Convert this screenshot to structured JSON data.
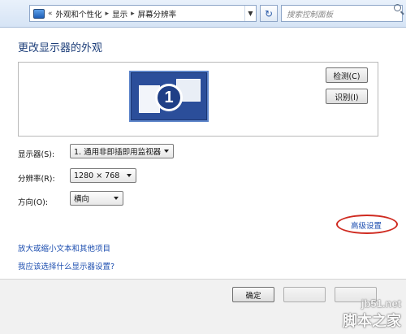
{
  "address_bar": {
    "breadcrumbs": [
      "外观和个性化",
      "显示",
      "屏幕分辨率"
    ],
    "prefix": "«",
    "separator": "▸",
    "search_placeholder": "搜索控制面板"
  },
  "page": {
    "title": "更改显示器的外观"
  },
  "preview": {
    "monitor_number": "1",
    "detect_button": "检测(C)",
    "identify_button": "识别(I)"
  },
  "form": {
    "display_label": "显示器(S):",
    "display_value": "1. 通用非即插即用监视器",
    "resolution_label": "分辨率(R):",
    "resolution_value": "1280 × 768",
    "orientation_label": "方向(O):",
    "orientation_value": "横向"
  },
  "links": {
    "advanced": "高级设置",
    "text_size": "放大或缩小文本和其他项目",
    "which_settings": "我应该选择什么显示器设置?"
  },
  "footer": {
    "ok_button": "确定",
    "cancel_button": "",
    "apply_button": ""
  },
  "watermark": {
    "url": "jb51.net",
    "site": "脚本之家"
  },
  "colors": {
    "highlight_oval": "#cf2a20",
    "link": "#1e4fb0",
    "title": "#1e3f7a"
  }
}
